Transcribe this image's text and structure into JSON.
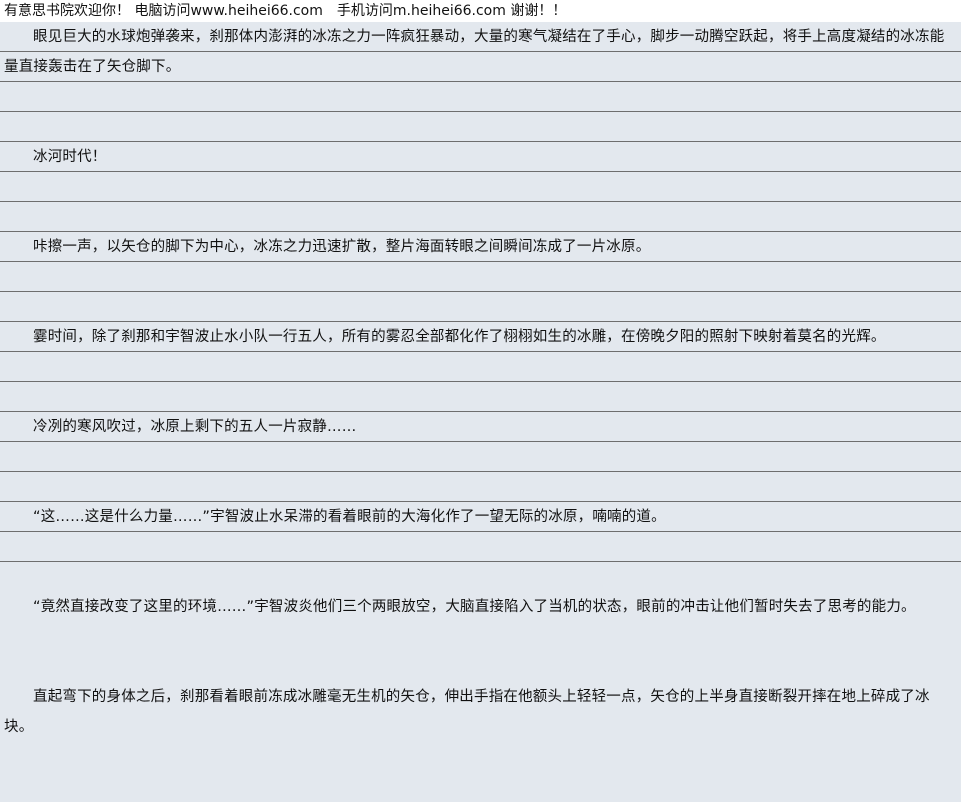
{
  "banner": {
    "text": "有意思书院欢迎你！ 电脑访问www.heihei66.com　手机访问m.heihei66.com 谢谢！！"
  },
  "paragraphs": [
    "眼见巨大的水球炮弹袭来，刹那体内澎湃的冰冻之力一阵疯狂暴动，大量的寒气凝结在了手心，脚步一动腾空跃起，将手上高度凝结的冰冻能量直接轰击在了矢仓脚下。",
    "冰河时代！",
    "咔擦一声，以矢仓的脚下为中心，冰冻之力迅速扩散，整片海面转眼之间瞬间冻成了一片冰原。",
    "霎时间，除了刹那和宇智波止水小队一行五人，所有的雾忍全部都化作了栩栩如生的冰雕，在傍晚夕阳的照射下映射着莫名的光辉。",
    "冷冽的寒风吹过，冰原上剩下的五人一片寂静……",
    "“这……这是什么力量……”宇智波止水呆滞的看着眼前的大海化作了一望无际的冰原，喃喃的道。",
    "“竟然直接改变了这里的环境……”宇智波炎他们三个两眼放空，大脑直接陷入了当机的状态，眼前的冲击让他们暂时失去了思考的能力。",
    "直起弯下的身体之后，刹那看着眼前冻成冰雕毫无生机的矢仓，伸出手指在他额头上轻轻一点，矢仓的上半身直接断裂开摔在地上碎成了冰块。"
  ]
}
